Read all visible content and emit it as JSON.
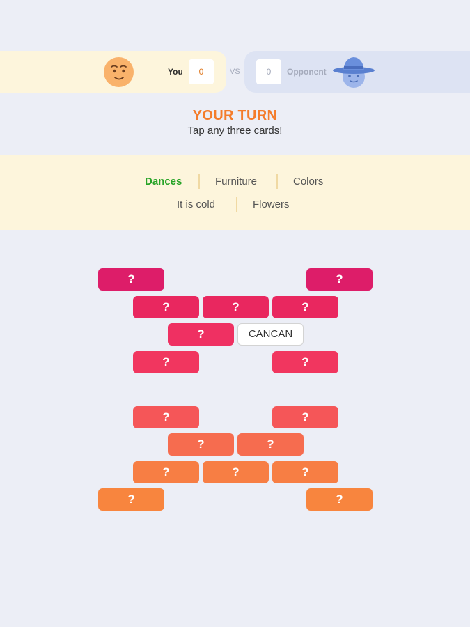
{
  "players": {
    "you": {
      "name": "You",
      "score": "0"
    },
    "vs": "VS",
    "opponent": {
      "name": "Opponent",
      "score": "0"
    }
  },
  "turn": {
    "title": "YOUR TURN",
    "hint": "Tap any three cards!"
  },
  "categories": [
    {
      "label": "Dances",
      "active": true
    },
    {
      "label": "Furniture",
      "active": false
    },
    {
      "label": "Colors",
      "active": false
    },
    {
      "label": "It is cold",
      "active": false
    },
    {
      "label": "Flowers",
      "active": false
    }
  ],
  "cards": [
    {
      "text": "?",
      "color": "#dd1d69"
    },
    {
      "text": "?",
      "color": "#dd1d69"
    },
    {
      "text": "?",
      "color": "#e9275f"
    },
    {
      "text": "?",
      "color": "#e9275f"
    },
    {
      "text": "?",
      "color": "#e9275f"
    },
    {
      "text": "?",
      "color": "#ef3062"
    },
    {
      "text": "CANCAN",
      "color": "#ffffff",
      "revealed": true
    },
    {
      "text": "?",
      "color": "#f1365f"
    },
    {
      "text": "?",
      "color": "#f1365f"
    },
    {
      "text": "?",
      "color": "#f55658"
    },
    {
      "text": "?",
      "color": "#f55658"
    },
    {
      "text": "?",
      "color": "#f66c4f"
    },
    {
      "text": "?",
      "color": "#f66c4f"
    },
    {
      "text": "?",
      "color": "#f77e44"
    },
    {
      "text": "?",
      "color": "#f77e44"
    },
    {
      "text": "?",
      "color": "#f77e44"
    },
    {
      "text": "?",
      "color": "#f8853e"
    },
    {
      "text": "?",
      "color": "#f8853e"
    }
  ]
}
